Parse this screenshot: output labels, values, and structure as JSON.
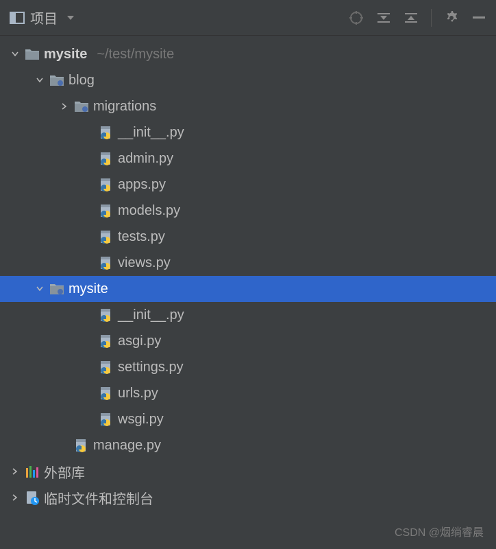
{
  "toolbar": {
    "title": "项目"
  },
  "tree": {
    "root": {
      "name": "mysite",
      "path": "~/test/mysite"
    },
    "blog": {
      "name": "blog",
      "migrations": "migrations",
      "files": [
        "__init__.py",
        "admin.py",
        "apps.py",
        "models.py",
        "tests.py",
        "views.py"
      ]
    },
    "mysite_pkg": {
      "name": "mysite",
      "files": [
        "__init__.py",
        "asgi.py",
        "settings.py",
        "urls.py",
        "wsgi.py"
      ]
    },
    "manage": "manage.py",
    "external_libs": "外部库",
    "scratches": "临时文件和控制台"
  },
  "watermark": "CSDN @烟绱睿晨"
}
